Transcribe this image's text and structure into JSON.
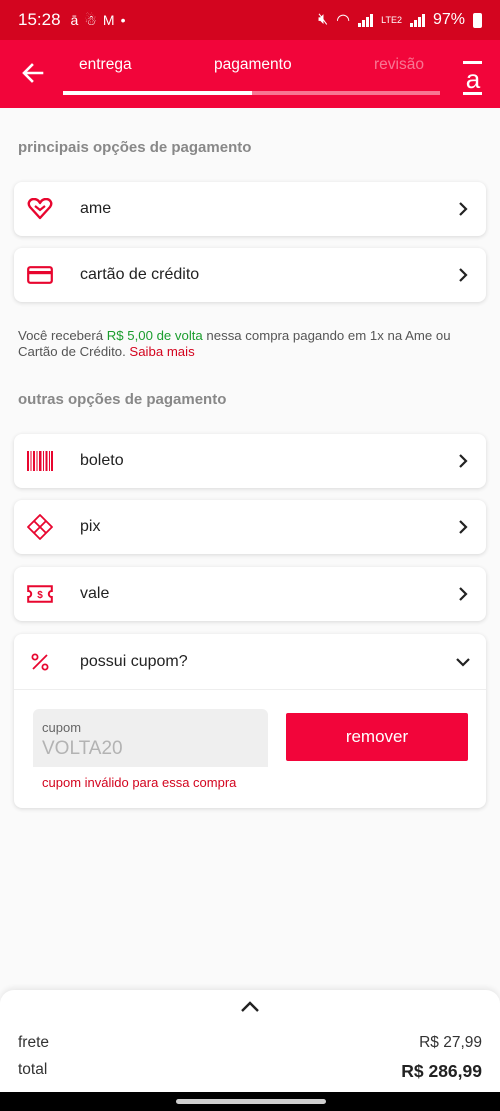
{
  "status_bar": {
    "time": "15:28",
    "battery": "97%",
    "network": "LTE2"
  },
  "header": {
    "tabs": [
      {
        "label": "entrega",
        "state": "done"
      },
      {
        "label": "pagamento",
        "state": "active"
      },
      {
        "label": "revisão",
        "state": "pending"
      }
    ],
    "progress_fraction": 0.5,
    "logo_letter": "a"
  },
  "main_options": {
    "title": "principais opções de pagamento",
    "items": [
      {
        "label": "ame",
        "icon": "heart-icon"
      },
      {
        "label": "cartão de crédito",
        "icon": "credit-card-icon"
      }
    ]
  },
  "cashback": {
    "prefix": "Você receberá ",
    "amount": "R$ 5,00 de volta",
    "suffix": " nessa compra pagando em 1x na Ame ou Cartão de Crédito. ",
    "link": "Saiba mais"
  },
  "other_options": {
    "title": "outras opções de pagamento",
    "items": [
      {
        "label": "boleto",
        "icon": "barcode-icon"
      },
      {
        "label": "pix",
        "icon": "pix-icon"
      },
      {
        "label": "vale",
        "icon": "voucher-icon"
      }
    ]
  },
  "coupon": {
    "question": "possui cupom?",
    "field_label": "cupom",
    "field_value": "VOLTA20",
    "remove_label": "remover",
    "error": "cupom inválido para essa compra"
  },
  "summary": {
    "shipping_label": "frete",
    "shipping_value": "R$ 27,99",
    "total_label": "total",
    "total_value": "R$ 286,99"
  },
  "colors": {
    "brand": "#f2053a",
    "status_bar": "#d3051f",
    "cashback_green": "#1b9d2e"
  }
}
